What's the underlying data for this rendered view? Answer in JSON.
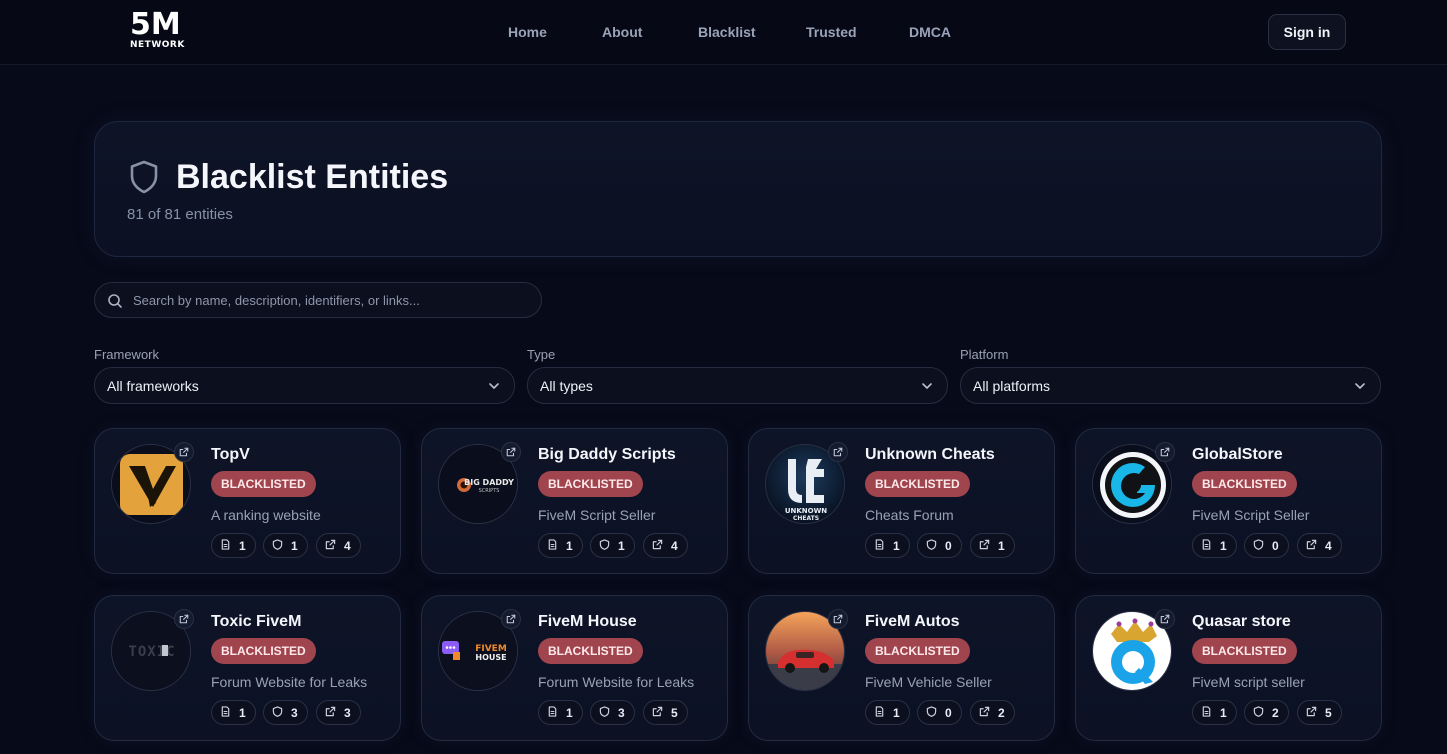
{
  "brand": {
    "big": "5M",
    "small": "NETWORK"
  },
  "nav": [
    {
      "label": "Home"
    },
    {
      "label": "About"
    },
    {
      "label": "Blacklist"
    },
    {
      "label": "Trusted"
    },
    {
      "label": "DMCA"
    }
  ],
  "signin_label": "Sign in",
  "hero": {
    "title": "Blacklist Entities",
    "subtitle": "81 of 81 entities"
  },
  "search": {
    "placeholder": "Search by name, description, identifiers, or links..."
  },
  "filters": [
    {
      "label": "Framework",
      "value": "All frameworks"
    },
    {
      "label": "Type",
      "value": "All types"
    },
    {
      "label": "Platform",
      "value": "All platforms"
    }
  ],
  "status_label": "BLACKLISTED",
  "cards": [
    {
      "name": "TopV",
      "desc": "A ranking website",
      "docs": "1",
      "shields": "1",
      "links": "4",
      "logo": "topv-logo"
    },
    {
      "name": "Big Daddy Scripts",
      "desc": "FiveM Script Seller",
      "docs": "1",
      "shields": "1",
      "links": "4",
      "logo": "big-daddy-logo"
    },
    {
      "name": "Unknown Cheats",
      "desc": "Cheats Forum",
      "docs": "1",
      "shields": "0",
      "links": "1",
      "logo": "unknown-cheats-logo"
    },
    {
      "name": "GlobalStore",
      "desc": "FiveM Script Seller",
      "docs": "1",
      "shields": "0",
      "links": "4",
      "logo": "globalstore-logo"
    },
    {
      "name": "Toxic FiveM",
      "desc": "Forum Website for Leaks",
      "docs": "1",
      "shields": "3",
      "links": "3",
      "logo": "toxic-logo"
    },
    {
      "name": "FiveM House",
      "desc": "Forum Website for Leaks",
      "docs": "1",
      "shields": "3",
      "links": "5",
      "logo": "fivem-house-logo"
    },
    {
      "name": "FiveM Autos",
      "desc": "FiveM Vehicle Seller",
      "docs": "1",
      "shields": "0",
      "links": "2",
      "logo": "fivem-autos-logo"
    },
    {
      "name": "Quasar store",
      "desc": "FiveM script seller",
      "docs": "1",
      "shields": "2",
      "links": "5",
      "logo": "quasar-logo"
    }
  ],
  "logo_text": {
    "big_daddy": "BIG DADDY",
    "big_daddy_sub": "SCRIPTS",
    "unknown_cheats": "UNKNOWN",
    "unknown_cheats_sub": "CHEATS",
    "toxic": "TOXIC",
    "fivem_house": "FIVEM",
    "fivem_house_sub": "HOUSE"
  }
}
